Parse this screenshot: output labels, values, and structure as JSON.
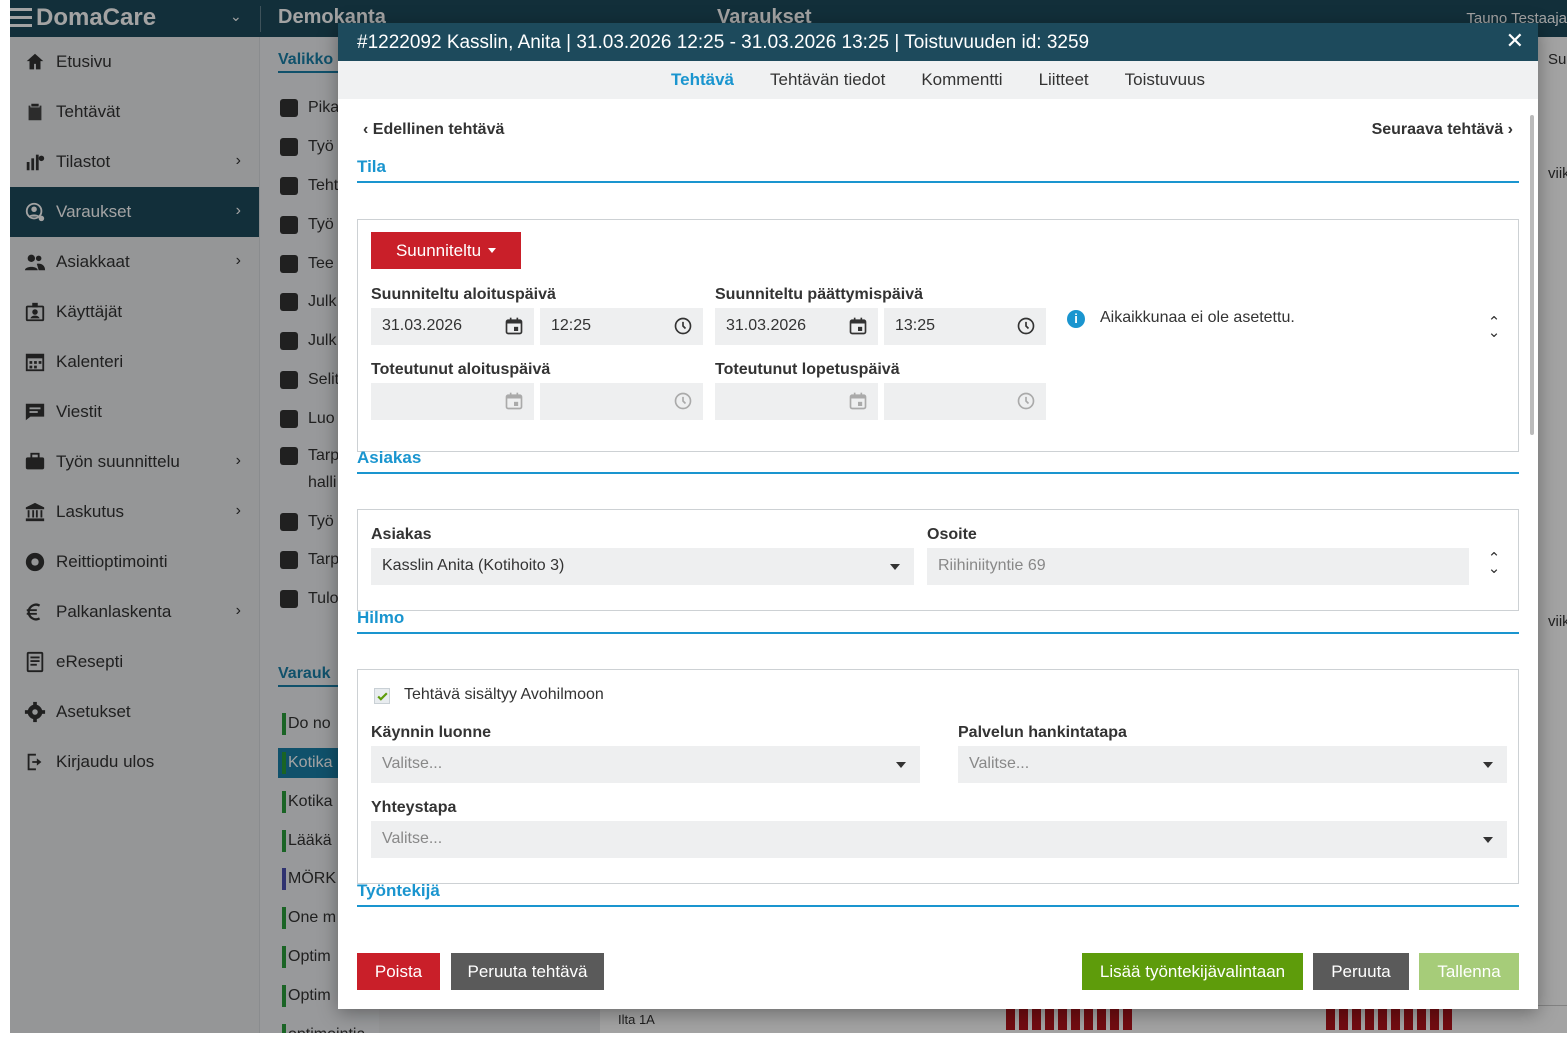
{
  "topbar": {
    "brand": "DomaCare",
    "database": "Demokanta",
    "page": "Varaukset",
    "user": "Tauno Testaaja"
  },
  "sidebar": {
    "items": [
      {
        "label": "Etusivu",
        "icon": "home-icon",
        "has_chevron": false
      },
      {
        "label": "Tehtävät",
        "icon": "clipboard-icon",
        "has_chevron": false
      },
      {
        "label": "Tilastot",
        "icon": "stats-icon",
        "has_chevron": true
      },
      {
        "label": "Varaukset",
        "icon": "booking-icon",
        "has_chevron": true,
        "active": true
      },
      {
        "label": "Asiakkaat",
        "icon": "customers-icon",
        "has_chevron": true
      },
      {
        "label": "Käyttäjät",
        "icon": "users-icon",
        "has_chevron": false
      },
      {
        "label": "Kalenteri",
        "icon": "calendar-icon",
        "has_chevron": false
      },
      {
        "label": "Viestit",
        "icon": "message-icon",
        "has_chevron": false
      },
      {
        "label": "Työn suunnittelu",
        "icon": "briefcase-icon",
        "has_chevron": true
      },
      {
        "label": "Laskutus",
        "icon": "bank-icon",
        "has_chevron": true
      },
      {
        "label": "Reittioptimointi",
        "icon": "aperture-icon",
        "has_chevron": false
      },
      {
        "label": "Palkanlaskenta",
        "icon": "euro-icon",
        "has_chevron": true
      },
      {
        "label": "eResepti",
        "icon": "prescription-icon",
        "has_chevron": false
      },
      {
        "label": "Asetukset",
        "icon": "gear-icon",
        "has_chevron": false
      },
      {
        "label": "Kirjaudu ulos",
        "icon": "logout-icon",
        "has_chevron": false
      }
    ]
  },
  "submenu": {
    "heading1": "Valikko",
    "items": [
      "Pika",
      "Työ",
      "Teht",
      "Työ",
      "Tee",
      "Julk",
      "Julk",
      "Selit",
      "Luo",
      "Tarp",
      "halli",
      "Työ",
      "Tarp",
      "Tulo"
    ],
    "heading2": "Varauk",
    "groups": [
      "Do no",
      "Kotika",
      "Kotika",
      "Lääkä",
      "MÖRK",
      "One m",
      "Optim",
      "Optim",
      "optimointia"
    ],
    "group_colors": [
      "#2a9d3a",
      "#2a9d3a",
      "#2a9d3a",
      "#2a9d3a",
      "#4a4fb0",
      "#2a9d3a",
      "#2a9d3a",
      "#2a9d3a",
      "#2a9d3a"
    ]
  },
  "background": {
    "right_top": "Suo",
    "right_mid1": "viikk",
    "right_mid2": "viikk",
    "bottom_cell": "Ilta 1A"
  },
  "modal": {
    "title": "#1222092 Kasslin, Anita | 31.03.2026 12:25 - 31.03.2026 13:25 | Toistuvuuden id: 3259",
    "close": "✕",
    "tabs": [
      "Tehtävä",
      "Tehtävän tiedot",
      "Kommentti",
      "Liitteet",
      "Toistuvuus"
    ],
    "prev_task": "Edellinen tehtävä",
    "next_task": "Seuraava tehtävä",
    "tila": {
      "heading": "Tila",
      "status": "Suunniteltu",
      "planned_start_label": "Suunniteltu aloituspäivä",
      "planned_start_date": "31.03.2026",
      "planned_start_time": "12:25",
      "planned_end_label": "Suunniteltu päättymispäivä",
      "planned_end_date": "31.03.2026",
      "planned_end_time": "13:25",
      "actual_start_label": "Toteutunut aloituspäivä",
      "actual_end_label": "Toteutunut lopetuspäivä",
      "info": "Aikaikkunaa ei ole asetettu."
    },
    "asiakas": {
      "heading": "Asiakas",
      "customer_label": "Asiakas",
      "customer_value": "Kasslin Anita (Kotihoito 3)",
      "address_label": "Osoite",
      "address_placeholder": "Riihiniityntie 69"
    },
    "hilmo": {
      "heading": "Hilmo",
      "checkbox_label": "Tehtävä sisältyy Avohilmoon",
      "visit_type_label": "Käynnin luonne",
      "visit_type_placeholder": "Valitse...",
      "procurement_label": "Palvelun hankintatapa",
      "procurement_placeholder": "Valitse...",
      "contact_label": "Yhteystapa",
      "contact_placeholder": "Valitse..."
    },
    "employee": {
      "heading": "Työntekijä"
    },
    "footer": {
      "delete": "Poista",
      "cancel_task": "Peruuta tehtävä",
      "add_employee": "Lisää työntekijävalintaan",
      "cancel": "Peruuta",
      "save": "Tallenna"
    }
  },
  "colors": {
    "header": "#1d4a5c",
    "accent": "#1a95cf",
    "danger": "#c91f29",
    "success": "#5e9c0b",
    "success_light": "#a6cc79",
    "neutral": "#5a5a5a"
  }
}
